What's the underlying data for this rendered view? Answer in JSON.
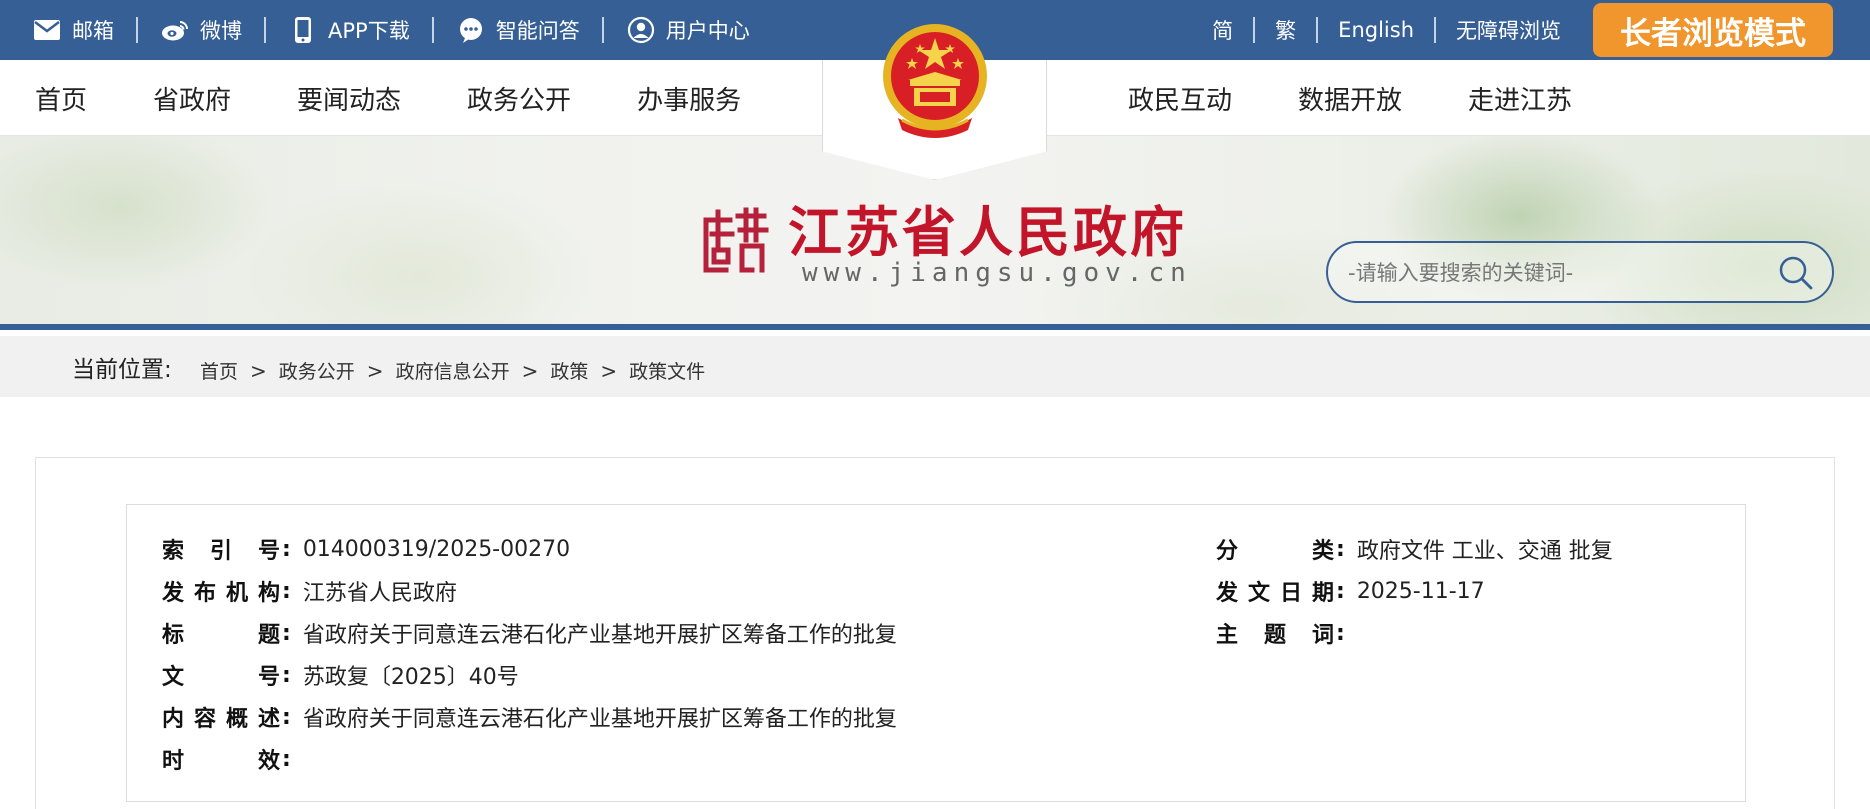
{
  "topbar": {
    "left_items": [
      {
        "label": "邮箱",
        "icon": "mail-icon"
      },
      {
        "label": "微博",
        "icon": "weibo-icon"
      },
      {
        "label": "APP下载",
        "icon": "phone-icon"
      },
      {
        "label": "智能问答",
        "icon": "chat-icon"
      },
      {
        "label": "用户中心",
        "icon": "user-icon"
      }
    ],
    "right_items": [
      "简",
      "繁",
      "English",
      "无障碍浏览"
    ],
    "elder_mode_label": "长者浏览模式",
    "colors": {
      "bar": "#365f95",
      "elder_button": "#f0962c"
    }
  },
  "nav": {
    "left": [
      "首页",
      "省政府",
      "要闻动态",
      "政务公开",
      "办事服务"
    ],
    "right": [
      "政民互动",
      "数据开放",
      "走进江苏"
    ]
  },
  "banner": {
    "title": "江苏省人民政府",
    "url": "www.jiangsu.gov.cn",
    "search_placeholder": "-请输入要搜索的关键词-",
    "title_color": "#c2152a"
  },
  "breadcrumb": {
    "label": "当前位置:",
    "items": [
      "首页",
      "政务公开",
      "政府信息公开",
      "政策",
      "政策文件"
    ],
    "separator": ">"
  },
  "document_info": {
    "index_no": {
      "label": "索引号",
      "value": "014000319/2025-00270"
    },
    "publisher": {
      "label": "发布机构",
      "value": "江苏省人民政府"
    },
    "title": {
      "label": "标题",
      "value": "省政府关于同意连云港石化产业基地开展扩区筹备工作的批复"
    },
    "doc_no": {
      "label": "文号",
      "value": "苏政复〔2025〕40号"
    },
    "summary": {
      "label": "内容概述",
      "value": "省政府关于同意连云港石化产业基地开展扩区筹备工作的批复"
    },
    "validity": {
      "label": "时效",
      "value": ""
    },
    "category": {
      "label": "分类",
      "value": "政府文件 工业、交通 批复"
    },
    "issue_date": {
      "label": "发文日期",
      "value": "2025-11-17"
    },
    "keywords": {
      "label": "主题词",
      "value": ""
    }
  }
}
